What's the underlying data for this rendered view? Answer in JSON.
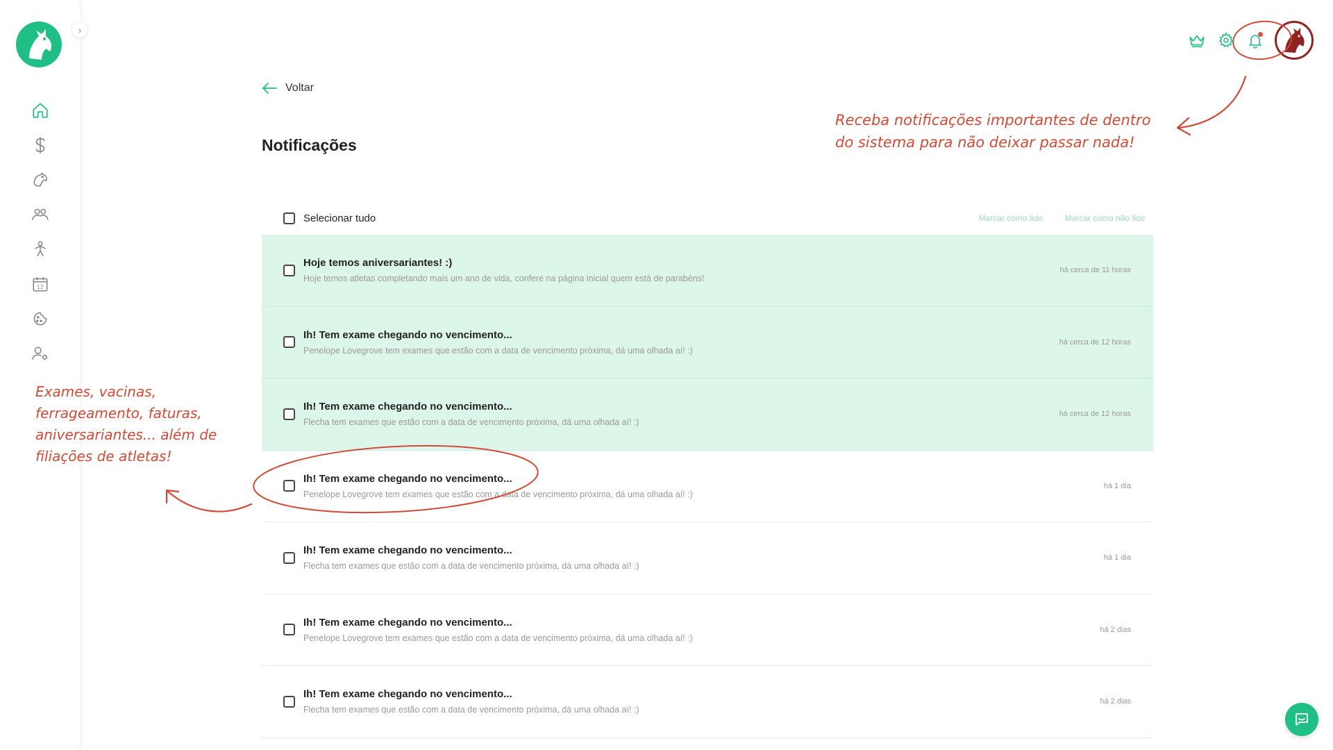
{
  "app": {
    "brand_color": "#1fbf86",
    "annotation_color": "#d04a36"
  },
  "sidebar": {
    "logo": "horse-logo",
    "collapse_icon": "chevron-right-icon",
    "items": [
      {
        "id": "home",
        "icon": "home-icon"
      },
      {
        "id": "finance",
        "icon": "dollar-icon"
      },
      {
        "id": "animals",
        "icon": "horse-head-icon"
      },
      {
        "id": "people",
        "icon": "users-icon"
      },
      {
        "id": "athletes",
        "icon": "athlete-icon"
      },
      {
        "id": "calendar",
        "icon": "calendar-icon"
      },
      {
        "id": "nutrition",
        "icon": "cookie-icon"
      },
      {
        "id": "user-settings",
        "icon": "user-gear-icon"
      }
    ]
  },
  "topbar": {
    "icons": [
      "crown-icon",
      "gear-icon",
      "bell-icon"
    ],
    "avatar": "horse-avatar"
  },
  "page": {
    "back_label": "Voltar",
    "title": "Notificações"
  },
  "list": {
    "select_all_label": "Selecionar tudo",
    "mark_read_label": "Marcar como lido",
    "mark_unread_label": "Marcar como não lido",
    "items": [
      {
        "title": "Hoje temos aniversariantes! :)",
        "description": "Hoje temos atletas completando mais um ano de vida, confere na página inicial quem está de parabéns!",
        "time": "há cerca de 11 horas",
        "unread": true
      },
      {
        "title": "Ih! Tem exame chegando no vencimento...",
        "description": "Penelope Lovegrove tem exames que estão com a data de vencimento próxima, dá uma olhada aí! :)",
        "time": "há cerca de 12 horas",
        "unread": true
      },
      {
        "title": "Ih! Tem exame chegando no vencimento...",
        "description": "Flecha tem exames que estão com a data de vencimento próxima, dá uma olhada aí! :)",
        "time": "há cerca de 12 horas",
        "unread": true
      },
      {
        "title": "Ih! Tem exame chegando no vencimento...",
        "description": "Penelope Lovegrove tem exames que estão com a data de vencimento próxima, dá uma olhada aí! :)",
        "time": "há 1 dia",
        "unread": false
      },
      {
        "title": "Ih! Tem exame chegando no vencimento...",
        "description": "Flecha tem exames que estão com a data de vencimento próxima, dá uma olhada aí! :)",
        "time": "há 1 dia",
        "unread": false
      },
      {
        "title": "Ih! Tem exame chegando no vencimento...",
        "description": "Penelope Lovegrove tem exames que estão com a data de vencimento próxima, dá uma olhada aí! :)",
        "time": "há 2 dias",
        "unread": false
      },
      {
        "title": "Ih! Tem exame chegando no vencimento...",
        "description": "Flecha tem exames que estão com a data de vencimento próxima, dá uma olhada aí! :)",
        "time": "há 2 dias",
        "unread": false
      }
    ]
  },
  "annotations": {
    "top_line1": "Receba notificações importantes de dentro",
    "top_line2": "do sistema para não deixar passar nada!",
    "left_line1": "Exames, vacinas,",
    "left_line2": "ferrageamento, faturas,",
    "left_line3": "aniversariantes... além de",
    "left_line4": "filiações de atletas!"
  },
  "chat": {
    "icon": "chat-icon"
  }
}
